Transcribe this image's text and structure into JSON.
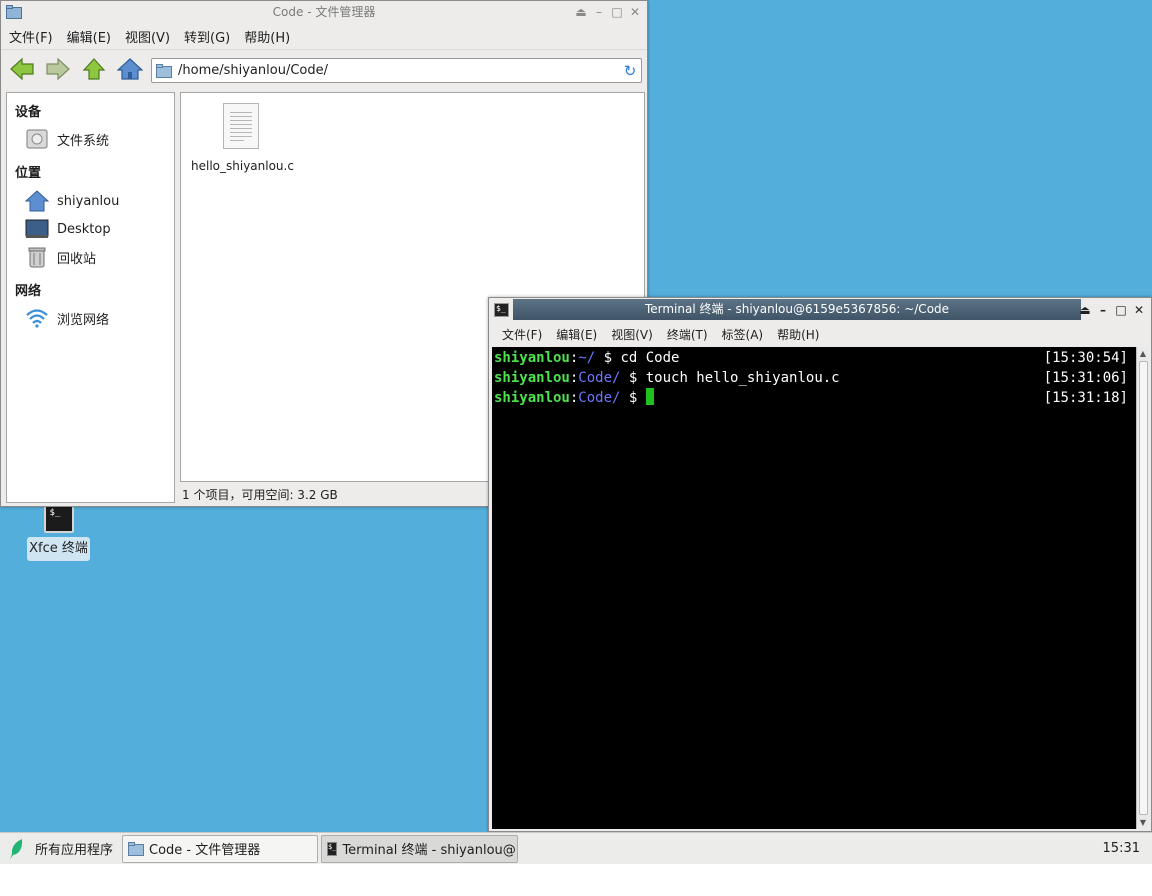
{
  "desktop": {
    "icons": [
      {
        "label": "Xfce 终端",
        "icon": "terminal-icon"
      }
    ]
  },
  "file_manager": {
    "title": "Code - 文件管理器",
    "menu": [
      "文件(F)",
      "编辑(E)",
      "视图(V)",
      "转到(G)",
      "帮助(H)"
    ],
    "toolbar": [
      "back-icon",
      "forward-icon",
      "up-icon",
      "home-icon"
    ],
    "address": "/home/shiyanlou/Code/",
    "sidebar": {
      "devices_header": "设备",
      "devices": [
        {
          "label": "文件系统",
          "icon": "drive-icon"
        }
      ],
      "places_header": "位置",
      "places": [
        {
          "label": "shiyanlou",
          "icon": "home-icon"
        },
        {
          "label": "Desktop",
          "icon": "desktop-icon"
        },
        {
          "label": "回收站",
          "icon": "trash-icon"
        }
      ],
      "network_header": "网络",
      "network": [
        {
          "label": "浏览网络",
          "icon": "wifi-icon"
        }
      ]
    },
    "files": [
      {
        "name": "hello_shiyanlou.c",
        "icon": "text-file-icon"
      }
    ],
    "status": "1 个项目，可用空间: 3.2 GB"
  },
  "terminal": {
    "title": "Terminal 终端 - shiyanlou@6159e5367856: ~/Code",
    "menu": [
      "文件(F)",
      "编辑(E)",
      "视图(V)",
      "终端(T)",
      "标签(A)",
      "帮助(H)"
    ],
    "lines": [
      {
        "user": "shiyanlou",
        "sep": ":",
        "path": "~/",
        "cmd": " $ cd Code",
        "time": "[15:30:54]"
      },
      {
        "user": "shiyanlou",
        "sep": ":",
        "path": "Code/",
        "cmd": " $ touch hello_shiyanlou.c",
        "time": "[15:31:06]"
      },
      {
        "user": "shiyanlou",
        "sep": ":",
        "path": "Code/",
        "cmd": " $ ",
        "time": "[15:31:18]"
      }
    ]
  },
  "taskbar": {
    "start_label": "所有应用程序",
    "tasks": [
      {
        "label": "Code - 文件管理器",
        "icon": "folder-icon"
      },
      {
        "label": "Terminal 终端 - shiyanlou@…",
        "icon": "terminal-icon"
      }
    ],
    "clock": "15:31"
  },
  "colors": {
    "desktop": "#53aedb",
    "terminal_user": "#4de34d",
    "terminal_path": "#6b77ff",
    "terminal_cursor": "#20c020",
    "title_active": "#4a6072"
  }
}
